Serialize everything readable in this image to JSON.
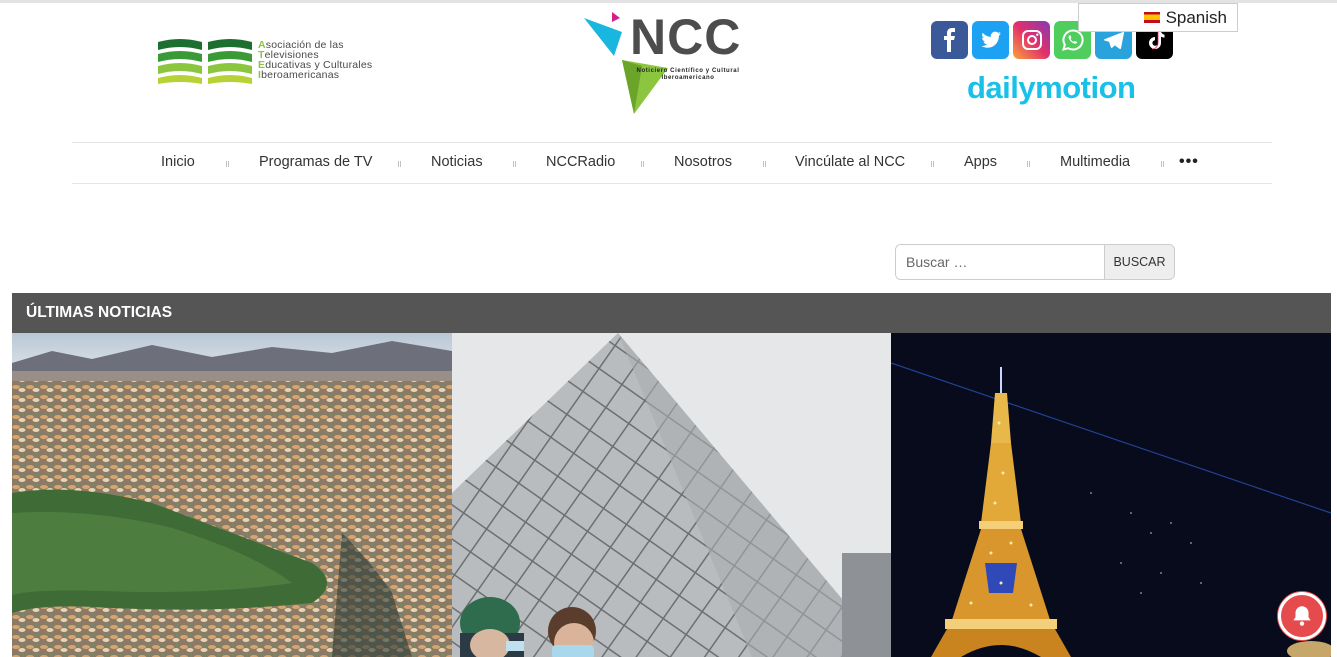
{
  "header": {
    "atei_logo": {
      "lines": [
        {
          "cap": "A",
          "rest": "sociación de las"
        },
        {
          "cap": "T",
          "rest": "elevisiones"
        },
        {
          "cap": "E",
          "rest": "ducativas y Culturales"
        },
        {
          "cap": "I",
          "rest": "beroamericanas"
        }
      ]
    },
    "ncc_logo": {
      "word": "NCC",
      "tagline_1": "Noticiero Científico y Cultural",
      "tagline_2": "Iberoamericano"
    },
    "social_icons": [
      "facebook-icon",
      "twitter-icon",
      "instagram-icon",
      "whatsapp-icon",
      "telegram-icon",
      "tiktok-icon"
    ],
    "dailymotion": "dailymotion",
    "language": "Spanish"
  },
  "nav": {
    "items": [
      "Inicio",
      "Programas de TV",
      "Noticias",
      "NCCRadio",
      "Nosotros",
      "Vincúlate al NCC",
      "Apps",
      "Multimedia"
    ],
    "more": "•••"
  },
  "search": {
    "placeholder": "Buscar …",
    "button": "BUSCAR"
  },
  "latest_news": {
    "title": "ÚLTIMAS NOTICIAS"
  },
  "colors": {
    "news_bar": "#555555",
    "atei_green": "#8cc63f",
    "dailymotion": "#19c0e8",
    "bell": "#e54b4d"
  }
}
